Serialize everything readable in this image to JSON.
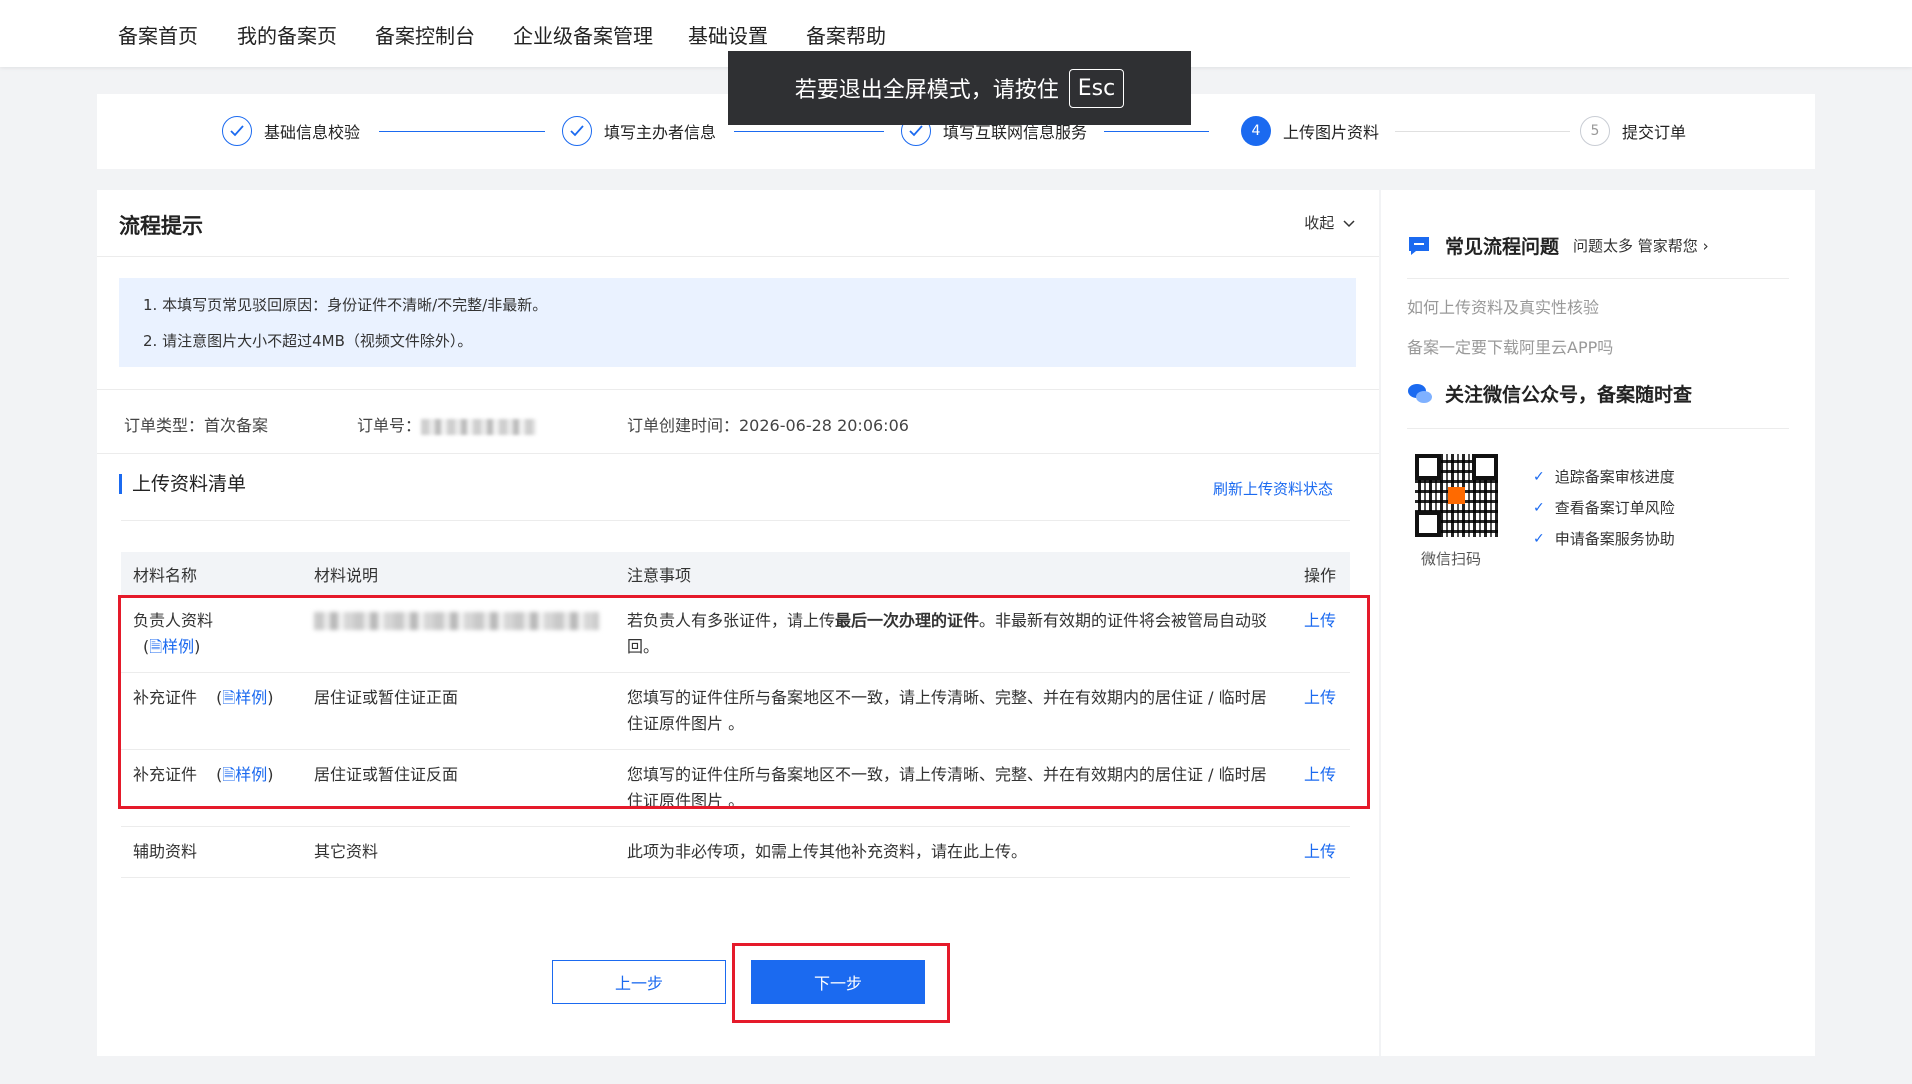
{
  "topnav": {
    "items": [
      "备案首页",
      "我的备案页",
      "备案控制台",
      "企业级备案管理",
      "基础设置",
      "备案帮助"
    ]
  },
  "toast": {
    "text": "若要退出全屏模式，请按住",
    "key": "Esc"
  },
  "steps": [
    {
      "label": "基础信息校验",
      "state": "done",
      "num": ""
    },
    {
      "label": "填写主办者信息",
      "state": "done",
      "num": ""
    },
    {
      "label": "填写互联网信息服务",
      "state": "done",
      "num": ""
    },
    {
      "label": "上传图片资料",
      "state": "active",
      "num": "4"
    },
    {
      "label": "提交订单",
      "state": "todo",
      "num": "5"
    }
  ],
  "main": {
    "title": "流程提示",
    "collapse": "收起",
    "notices": [
      "1. 本填写页常见驳回原因：身份证件不清晰/不完整/非最新。",
      "2. 请注意图片大小不超过4MB（视频文件除外）。"
    ],
    "order": {
      "type": "订单类型：首次备案",
      "number_label": "订单号：",
      "created": "订单创建时间：2026-06-28 20:06:06"
    },
    "section_title": "上传资料清单",
    "refresh": "刷新上传资料状态",
    "table": {
      "headers": [
        "材料名称",
        "材料说明",
        "注意事项",
        "操作"
      ],
      "rows": [
        {
          "name": "负责人资料",
          "sample": "样例",
          "desc": "",
          "note_pre": "若负责人有多张证件，请上传",
          "note_bold": "最后一次办理的证件",
          "note_post": "。非最新有效期的证件将会被管局自动驳回。",
          "action": "上传"
        },
        {
          "name": "补充证件",
          "sample": "样例",
          "desc": "居住证或暂住证正面",
          "note_pre": "您填写的证件住所与备案地区不一致，请上传清晰、完整、并在有效期内的居住证 / 临时居住证原件图片 。",
          "note_bold": "",
          "note_post": "",
          "action": "上传"
        },
        {
          "name": "补充证件",
          "sample": "样例",
          "desc": "居住证或暂住证反面",
          "note_pre": "您填写的证件住所与备案地区不一致，请上传清晰、完整、并在有效期内的居住证 / 临时居住证原件图片 。",
          "note_bold": "",
          "note_post": "",
          "action": "上传"
        },
        {
          "name": "辅助资料",
          "sample": "",
          "desc": "其它资料",
          "note_pre": "此项为非必传项，如需上传其他补充资料，请在此上传。",
          "note_bold": "",
          "note_post": "",
          "action": "上传"
        }
      ]
    },
    "prev": "上一步",
    "next": "下一步"
  },
  "side": {
    "faq_title": "常见流程问题",
    "faq_sub": "问题太多 管家帮您",
    "links": [
      "如何上传资料及真实性核验",
      "备案一定要下载阿里云APP吗"
    ],
    "wechat_title": "关注微信公众号，备案随时查",
    "qr_caption": "微信扫码",
    "checks": [
      "追踪备案审核进度",
      "查看备案订单风险",
      "申请备案服务协助"
    ]
  },
  "colors": {
    "primary": "#1b6af0",
    "highlight": "#e51a2a",
    "notice_bg": "#eaf2ff"
  }
}
